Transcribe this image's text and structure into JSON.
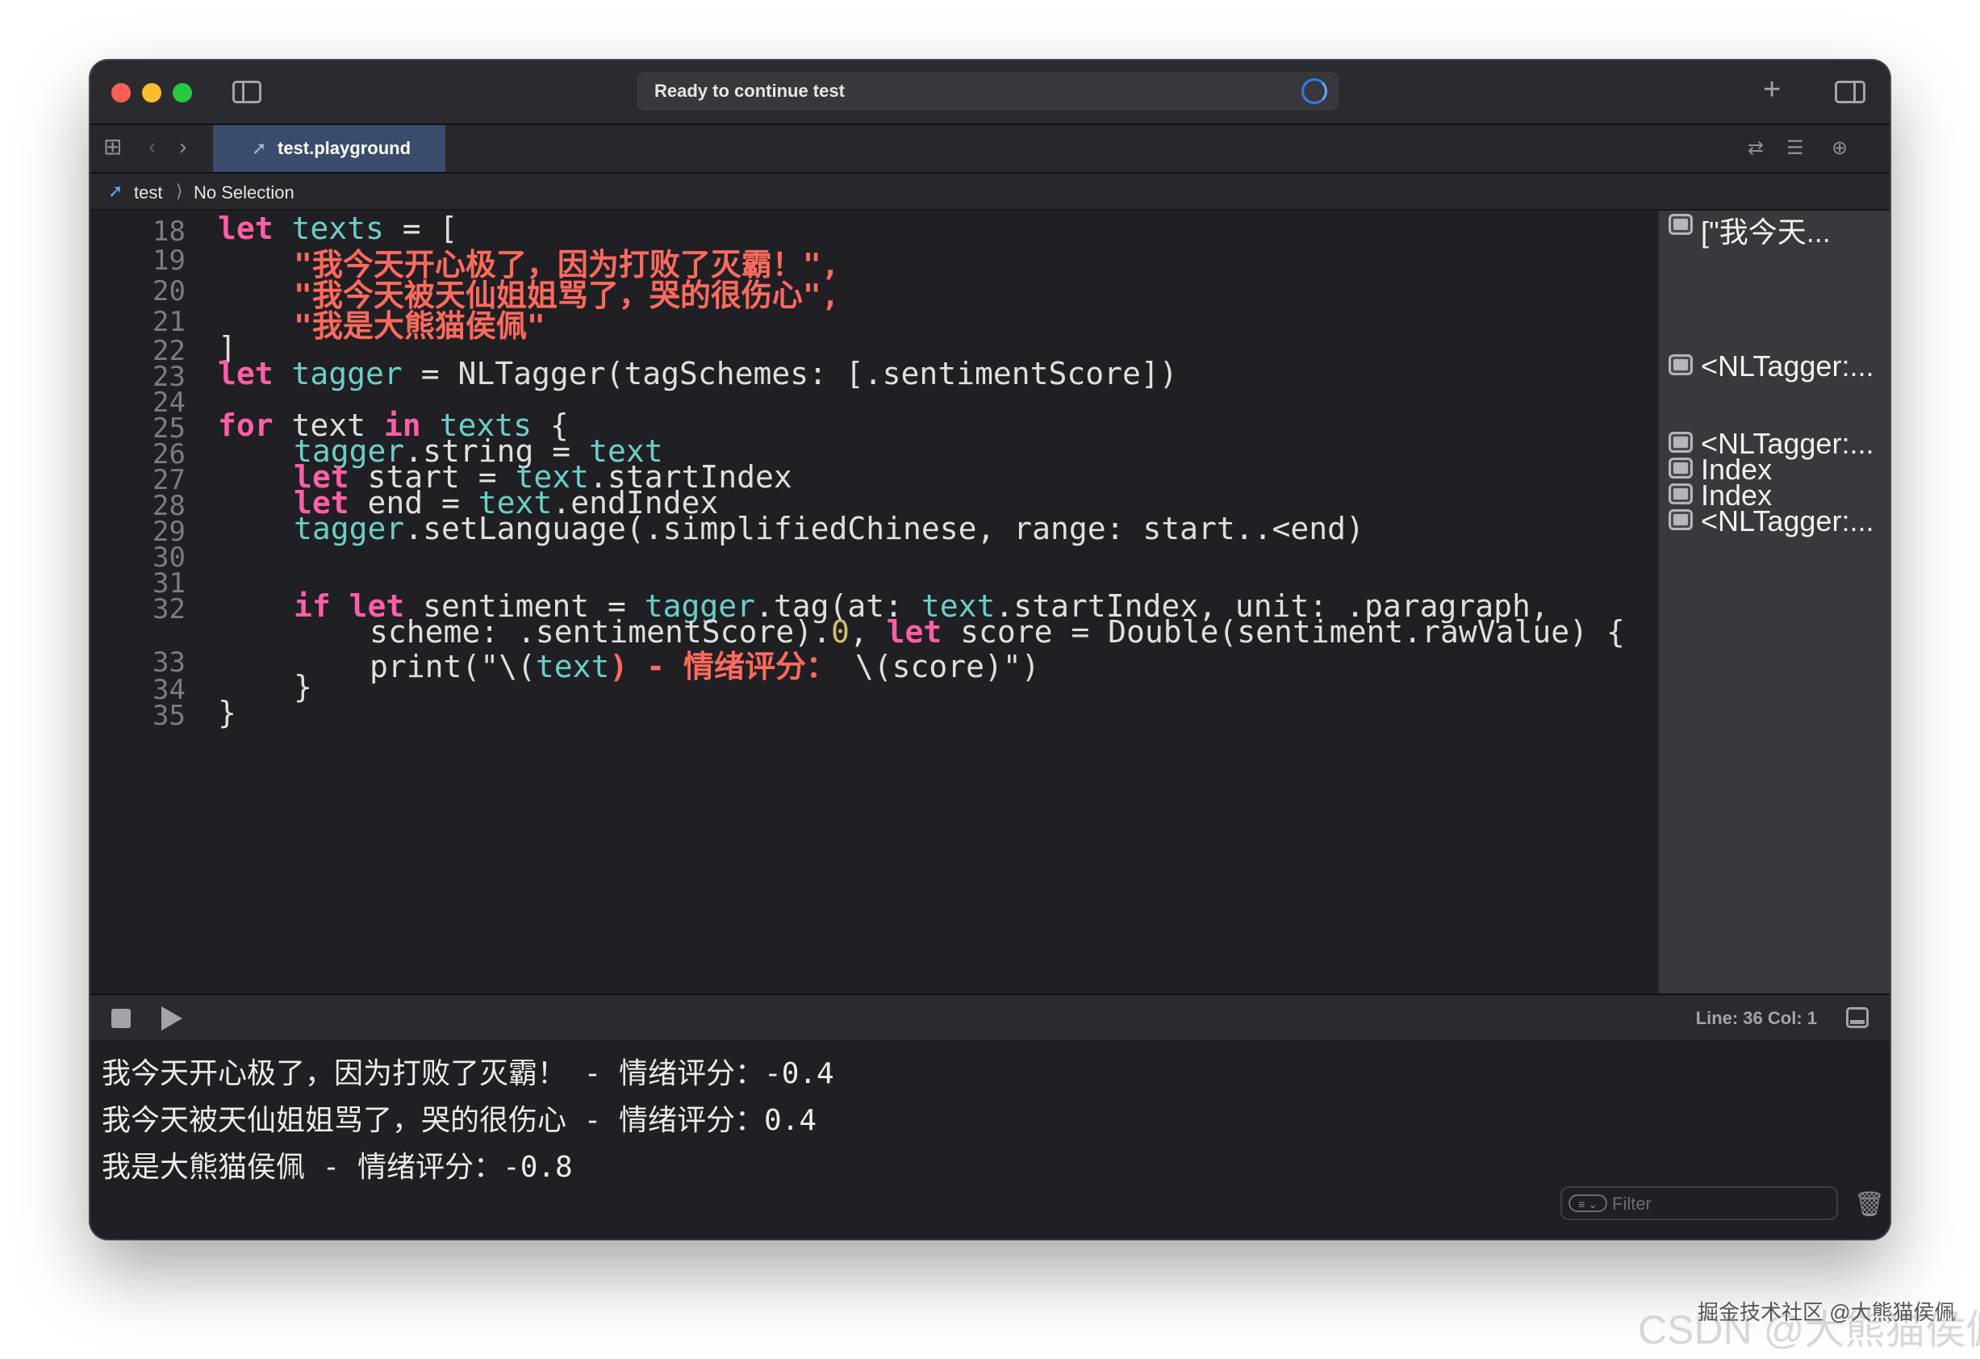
{
  "titlebar": {
    "status": "Ready to continue test"
  },
  "tab": {
    "label": "test.playground"
  },
  "jumpbar": {
    "project": "test",
    "separator": "⟩",
    "selection": "No Selection"
  },
  "code_lines": [
    {
      "num": "18"
    },
    {
      "num": "19"
    },
    {
      "num": "20"
    },
    {
      "num": "21"
    },
    {
      "num": "22"
    },
    {
      "num": "23"
    },
    {
      "num": "24"
    },
    {
      "num": "25"
    },
    {
      "num": "26"
    },
    {
      "num": "27"
    },
    {
      "num": "28"
    },
    {
      "num": "29"
    },
    {
      "num": "30"
    },
    {
      "num": "31"
    },
    {
      "num": "32"
    },
    {
      "num": "33"
    },
    {
      "num": "34"
    },
    {
      "num": "35"
    }
  ],
  "code": {
    "l18": [
      "let",
      "texts",
      " = ["
    ],
    "l19": "\"我今天开心极了，因为打败了灭霸！\",",
    "l20": "\"我今天被天仙姐姐骂了，哭的很伤心\",",
    "l21": "\"我是大熊猫侯佩\"",
    "l22": "]",
    "l23": [
      "let",
      "tagger",
      " = NLTagger(tagSchemes: [.sentimentScore])"
    ],
    "l25": [
      "for",
      " text ",
      "in",
      "texts",
      " {"
    ],
    "l26": [
      "tagger",
      ".string = ",
      "text"
    ],
    "l27": [
      "let",
      " start = ",
      "text",
      ".startIndex"
    ],
    "l28": [
      "let",
      " end = ",
      "text",
      ".endIndex"
    ],
    "l29": [
      "tagger",
      ".setLanguage(.simplifiedChinese, range: start..<end)"
    ],
    "l32a": [
      "if",
      "let",
      " sentiment = ",
      "tagger",
      ".tag(at: ",
      "text",
      ".startIndex, unit: .paragraph,"
    ],
    "l32b": [
      "scheme: .sentimentScore).",
      "0",
      ", ",
      "let",
      " score = Double(sentiment.rawValue) {"
    ],
    "l33": [
      "print(\"\\(",
      "text",
      ") - ",
      "情绪评分：",
      " \\(score)\")"
    ],
    "l34": "}",
    "l35": "}"
  },
  "results": [
    {
      "text": "[\"我今天..."
    },
    {
      "text": "<NLTagger:..."
    },
    {
      "text": "<NLTagger:..."
    },
    {
      "text": "Index"
    },
    {
      "text": "Index"
    },
    {
      "text": "<NLTagger:..."
    }
  ],
  "debug": {
    "line_col": "Line: 36  Col: 1"
  },
  "console": {
    "lines": [
      "我今天开心极了，因为打败了灭霸！ - 情绪评分：-0.4",
      "我今天被天仙姐姐骂了，哭的很伤心 - 情绪评分：0.4",
      "我是大熊猫侯佩 - 情绪评分：-0.8"
    ],
    "filter_placeholder": "Filter"
  },
  "watermark": {
    "main": "CSDN @大熊猫侯佩",
    "secondary": "掘金技术社区 @大熊猫侯佩"
  }
}
